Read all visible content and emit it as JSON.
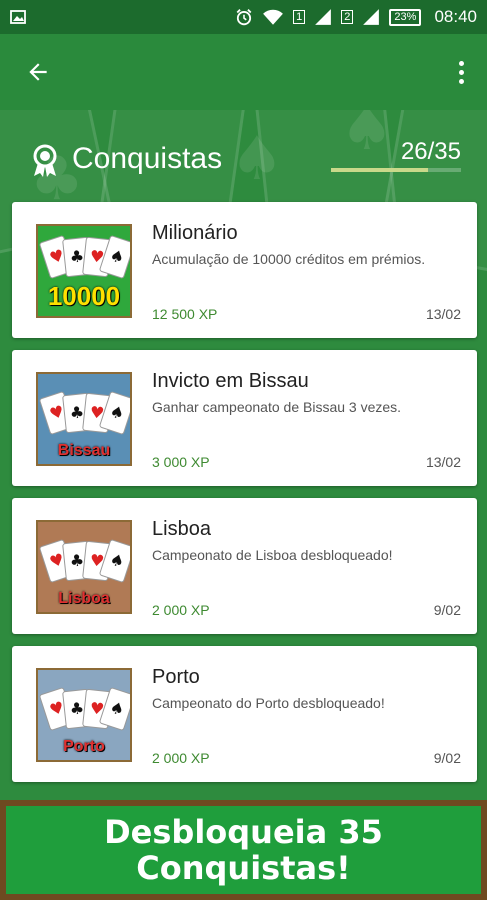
{
  "status_bar": {
    "left_icon": "image-icon",
    "sim1": "1",
    "sim2": "2",
    "battery": "23%",
    "time": "08:40"
  },
  "app_bar": {
    "back_icon": "arrow-back-icon",
    "menu_icon": "more-vert-icon"
  },
  "header": {
    "title": "Conquistas",
    "progress_text": "26/35",
    "progress_fraction": 0.743
  },
  "achievements": [
    {
      "name": "Milionário",
      "description": "Acumulação de 10000 créditos em prémios.",
      "xp": "12 500 XP",
      "date": "13/02",
      "thumb_label": "10000",
      "thumb_bg": "#2fa83c",
      "label_color": "#ffe100"
    },
    {
      "name": "Invicto em Bissau",
      "description": "Ganhar campeonato de Bissau 3 vezes.",
      "xp": "3 000 XP",
      "date": "13/02",
      "thumb_label": "Bissau",
      "thumb_bg": "#5a8fb5",
      "label_color": "#e03030"
    },
    {
      "name": "Lisboa",
      "description": "Campeonato de Lisboa desbloqueado!",
      "xp": "2 000 XP",
      "date": "9/02",
      "thumb_label": "Lisboa",
      "thumb_bg": "#b07a55",
      "label_color": "#e03030"
    },
    {
      "name": "Porto",
      "description": "Campeonato do Porto desbloqueado!",
      "xp": "2 000 XP",
      "date": "9/02",
      "thumb_label": "Porto",
      "thumb_bg": "#8aa6c0",
      "label_color": "#e03030"
    }
  ],
  "banner": {
    "line1": "Desbloqueia 35",
    "line2": "Conquistas!"
  },
  "colors": {
    "status_bar": "#1c6b2d",
    "app_bar": "#2a8a3c",
    "background": "#2e8b3e",
    "xp_text": "#3e8a31",
    "banner_border": "#6e4a20",
    "banner_fill": "#1f9e3c"
  }
}
